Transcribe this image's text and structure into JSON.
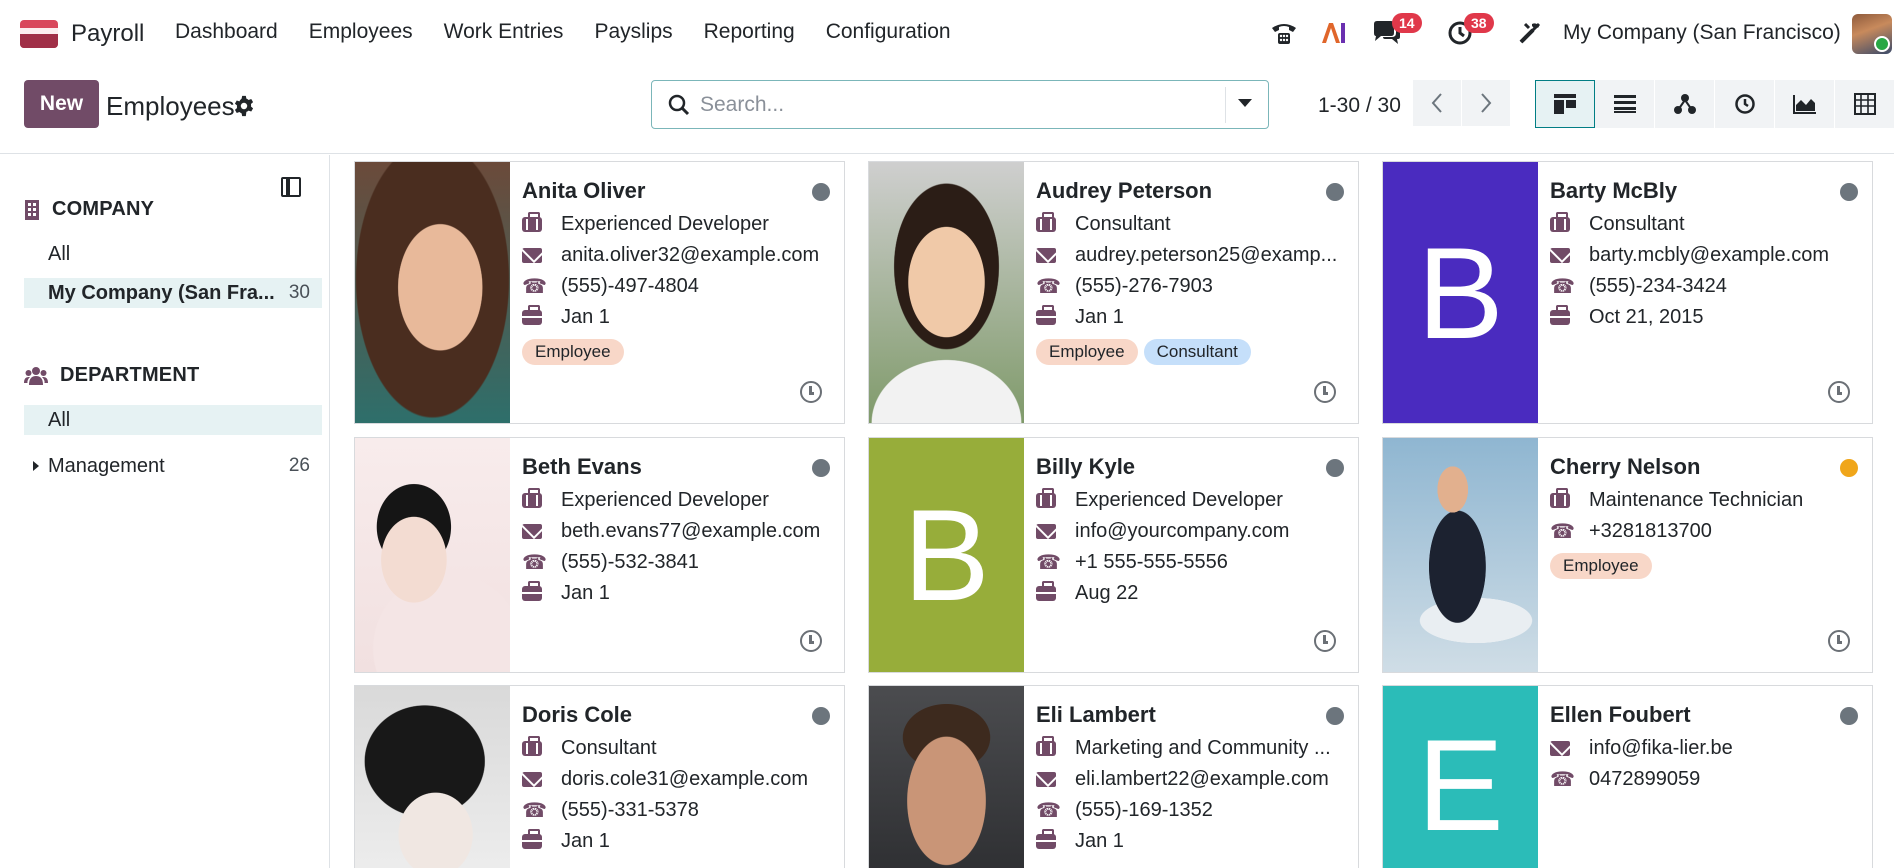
{
  "app": {
    "name": "Payroll"
  },
  "menu": [
    "Dashboard",
    "Employees",
    "Work Entries",
    "Payslips",
    "Reporting",
    "Configuration"
  ],
  "systray": {
    "messages_count": "14",
    "activities_count": "38",
    "company": "My Company (San Francisco)"
  },
  "control": {
    "new_label": "New",
    "title": "Employees",
    "search_placeholder": "Search...",
    "pager": "1-30 / 30"
  },
  "sidebar": {
    "company_header": "COMPANY",
    "company_items": [
      {
        "label": "All",
        "count": ""
      },
      {
        "label": "My Company (San Fra...",
        "count": "30"
      }
    ],
    "department_header": "DEPARTMENT",
    "department_items": [
      {
        "label": "All",
        "count": ""
      },
      {
        "label": "Management",
        "count": "26"
      }
    ]
  },
  "employees": [
    {
      "name": "Anita Oliver",
      "job": "Experienced Developer",
      "email": "anita.oliver32@example.com",
      "phone": "(555)-497-4804",
      "date": "Jan 1",
      "tags": [
        "Employee"
      ],
      "status": "offline"
    },
    {
      "name": "Audrey Peterson",
      "job": "Consultant",
      "email": "audrey.peterson25@examp...",
      "phone": "(555)-276-7903",
      "date": "Jan 1",
      "tags": [
        "Employee",
        "Consultant"
      ],
      "status": "offline"
    },
    {
      "name": "Barty McBly",
      "job": "Consultant",
      "email": "barty.mcbly@example.com",
      "phone": "(555)-234-3424",
      "date": "Oct 21, 2015",
      "tags": [],
      "status": "offline",
      "letter": "B",
      "color": "#4a2bbf"
    },
    {
      "name": "Beth Evans",
      "job": "Experienced Developer",
      "email": "beth.evans77@example.com",
      "phone": "(555)-532-3841",
      "date": "Jan 1",
      "tags": [],
      "status": "offline"
    },
    {
      "name": "Billy Kyle",
      "job": "Experienced Developer",
      "email": "info@yourcompany.com",
      "phone": "+1 555-555-5556",
      "date": "Aug 22",
      "tags": [],
      "status": "offline",
      "letter": "B",
      "color": "#97ad3a"
    },
    {
      "name": "Cherry Nelson",
      "job": "Maintenance Technician",
      "email": "",
      "phone": "+3281813700",
      "date": "",
      "tags": [
        "Employee"
      ],
      "status": "away"
    },
    {
      "name": "Doris Cole",
      "job": "Consultant",
      "email": "doris.cole31@example.com",
      "phone": "(555)-331-5378",
      "date": "Jan 1",
      "tags": [],
      "status": "offline"
    },
    {
      "name": "Eli Lambert",
      "job": "Marketing and Community ...",
      "email": "eli.lambert22@example.com",
      "phone": "(555)-169-1352",
      "date": "Jan 1",
      "tags": [],
      "status": "offline"
    },
    {
      "name": "Ellen Foubert",
      "job": "",
      "email": "info@fika-lier.be",
      "phone": "0472899059",
      "date": "",
      "tags": [],
      "status": "offline",
      "letter": "E",
      "color": "#2bbcb8"
    }
  ],
  "icons": {
    "navbar": [
      "phone-icon",
      "ai-icon",
      "messages-icon",
      "activity-clock-icon",
      "tools-icon"
    ],
    "card_rows": [
      "briefcase-icon",
      "envelope-icon",
      "phone-icon",
      "suitcase-icon"
    ]
  }
}
